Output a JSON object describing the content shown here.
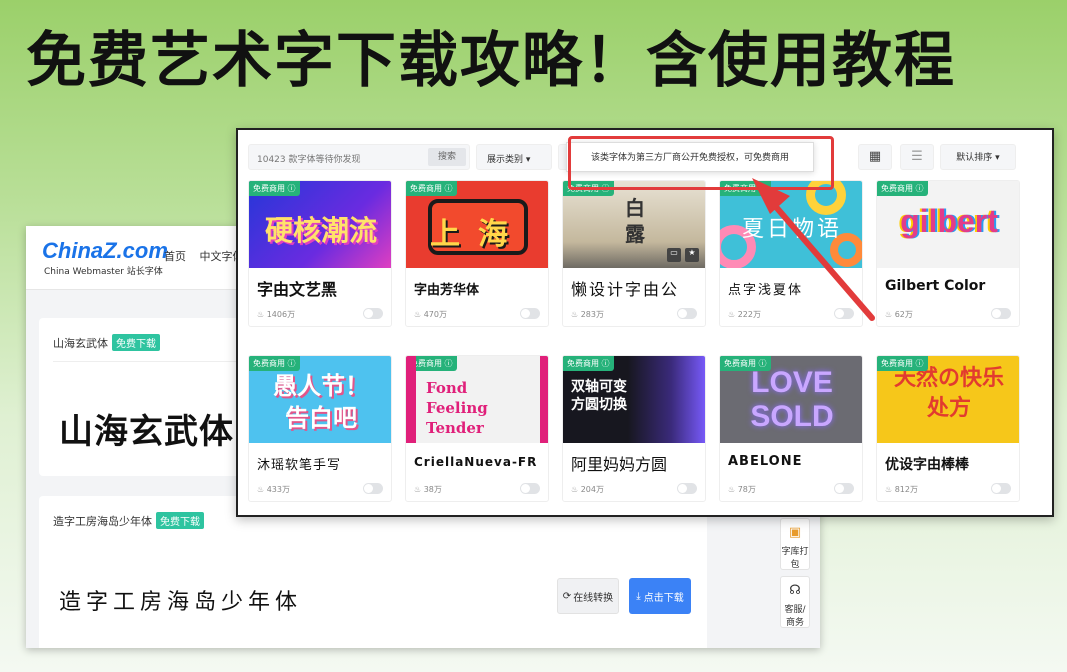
{
  "headline": "免费艺术字下载攻略！含使用教程",
  "background_site": {
    "logo": "ChinaZ.com",
    "logo_sub": "China Webmaster 站长字体",
    "nav": [
      "首页",
      "中文字体"
    ],
    "cards": [
      {
        "name": "山海玄武体",
        "tag": "免费下载",
        "preview": "山海玄武体"
      },
      {
        "name": "造字工房海岛少年体",
        "tag": "免费下载",
        "preview": "造字工房海岛少年体",
        "convert_label": "在线转换",
        "download_label": "点击下载"
      }
    ],
    "side_buttons": [
      "字库打包",
      "客服/商务"
    ]
  },
  "panel": {
    "search_placeholder": "10423 款字体等待你发现",
    "search_button": "搜索",
    "filter_label": "展示类别",
    "filter_partial": "预",
    "sort_label": "默认排序",
    "tooltip": "该类字体为第三方厂商公开免费授权，可免费商用",
    "badge_label": "免费商用",
    "fonts": [
      {
        "name": "字由文艺黑",
        "downloads": "1406万",
        "preview": "硬核潮流",
        "bg": "#2b3fe0",
        "fg": "#ffe26b"
      },
      {
        "name": "字由芳华体",
        "downloads": "470万",
        "preview": "上海",
        "bg": "#e93c2f",
        "fg": "#ffd64a"
      },
      {
        "name": "懒设计字由公",
        "downloads": "283万",
        "preview": "白露",
        "bg": "#d9cbb3",
        "fg": "#333333"
      },
      {
        "name": "点字浅夏体",
        "downloads": "222万",
        "preview": "夏日物语",
        "bg": "#3fc0d8",
        "fg": "#ffffff"
      },
      {
        "name": "Gilbert Color",
        "downloads": "62万",
        "preview": "gilbert",
        "bg": "#f3f3f3",
        "fg": "#e23c8a"
      },
      {
        "name": "沐瑶软笔手写",
        "downloads": "433万",
        "preview": "愚人节！告白吧",
        "bg": "#4ec2ef",
        "fg": "#ffffff"
      },
      {
        "name": "CriellaNueva-FR",
        "downloads": "38万",
        "preview": "Fond Feeling Tender",
        "bg": "#f2f2f2",
        "fg": "#e0207a"
      },
      {
        "name": "阿里妈妈方圆",
        "downloads": "204万",
        "preview": "双轴可变方圆切换",
        "bg": "#17171f",
        "fg": "#ffffff"
      },
      {
        "name": "ABELONE",
        "downloads": "78万",
        "preview": "LOVE SOLD",
        "bg": "#6b6b72",
        "fg": "#c9a7ff"
      },
      {
        "name": "优设字由棒棒",
        "downloads": "812万",
        "preview": "天然の快乐处方",
        "bg": "#f6c71a",
        "fg": "#e23b2f"
      }
    ]
  },
  "colors": {
    "highlight": "#e23b3b",
    "accent": "#3b82f6",
    "badge": "#26b27a"
  }
}
